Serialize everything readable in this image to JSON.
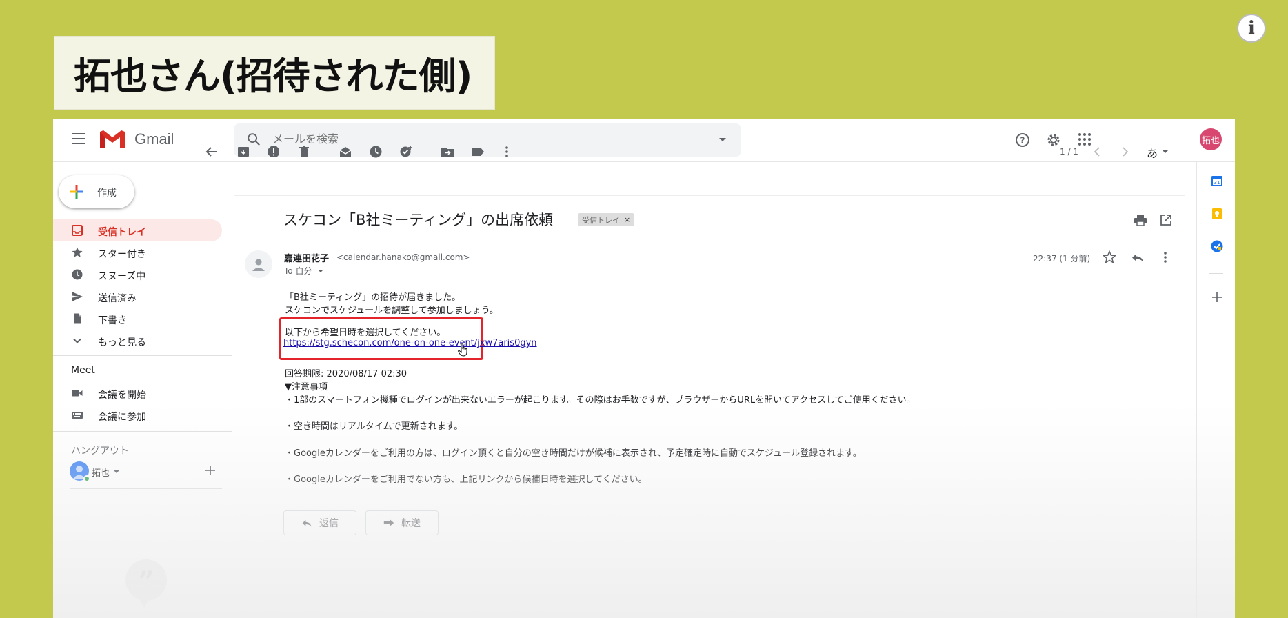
{
  "overlay": {
    "caption": "拓也さん(招待された側)",
    "info_glyph": "i"
  },
  "header": {
    "app_name": "Gmail",
    "search_placeholder": "メールを検索",
    "avatar_text": "拓也"
  },
  "sidebar": {
    "compose_label": "作成",
    "items": [
      {
        "label": "受信トレイ",
        "icon": "inbox-icon",
        "active": true
      },
      {
        "label": "スター付き",
        "icon": "star-icon"
      },
      {
        "label": "スヌーズ中",
        "icon": "clock-icon"
      },
      {
        "label": "送信済み",
        "icon": "send-icon"
      },
      {
        "label": "下書き",
        "icon": "draft-icon"
      },
      {
        "label": "もっと見る",
        "icon": "chevron-down-icon"
      }
    ],
    "meet": {
      "title": "Meet",
      "items": [
        {
          "label": "会議を開始",
          "icon": "video-icon"
        },
        {
          "label": "会議に参加",
          "icon": "keyboard-icon"
        }
      ]
    },
    "hangouts": {
      "title": "ハングアウト",
      "user": "拓也"
    }
  },
  "toolbar": {
    "page_count": "1 / 1",
    "input_tool": "あ"
  },
  "email": {
    "subject": "スケコン「B社ミーティング」の出席依頼",
    "label": "受信トレイ",
    "sender_name": "嘉連田花子",
    "sender_email": "<calendar.hanako@gmail.com>",
    "to": "To 自分",
    "timestamp": "22:37 (1 分前)",
    "body": {
      "line1": "「B社ミーティング」の招待が届きました。",
      "line2": "スケコンでスケジュールを調整して参加しましょう。",
      "line3": "以下から希望日時を選択してください。",
      "link": "https://stg.schecon.com/one-on-one-event/jxw7aris0gyn",
      "deadline": "回答期限: 2020/08/17 02:30",
      "notes_title": "▼注意事項",
      "note1": "・1部のスマートフォン機種でログインが出来ないエラーが起こります。その際はお手数ですが、ブラウザーからURLを開いてアクセスしてご使用ください。",
      "note2": "・空き時間はリアルタイムで更新されます。",
      "note3": "・Googleカレンダーをご利用の方は、ログイン頂くと自分の空き時間だけが候補に表示され、予定確定時に自動でスケジュール登録されます。",
      "note4": "・Googleカレンダーをご利用でない方も、上記リンクから候補日時を選択してください。"
    },
    "reply_label": "返信",
    "forward_label": "転送"
  },
  "colors": {
    "background": "#c2c94d",
    "accent_red": "#d93025",
    "highlight": "#e3242b"
  }
}
